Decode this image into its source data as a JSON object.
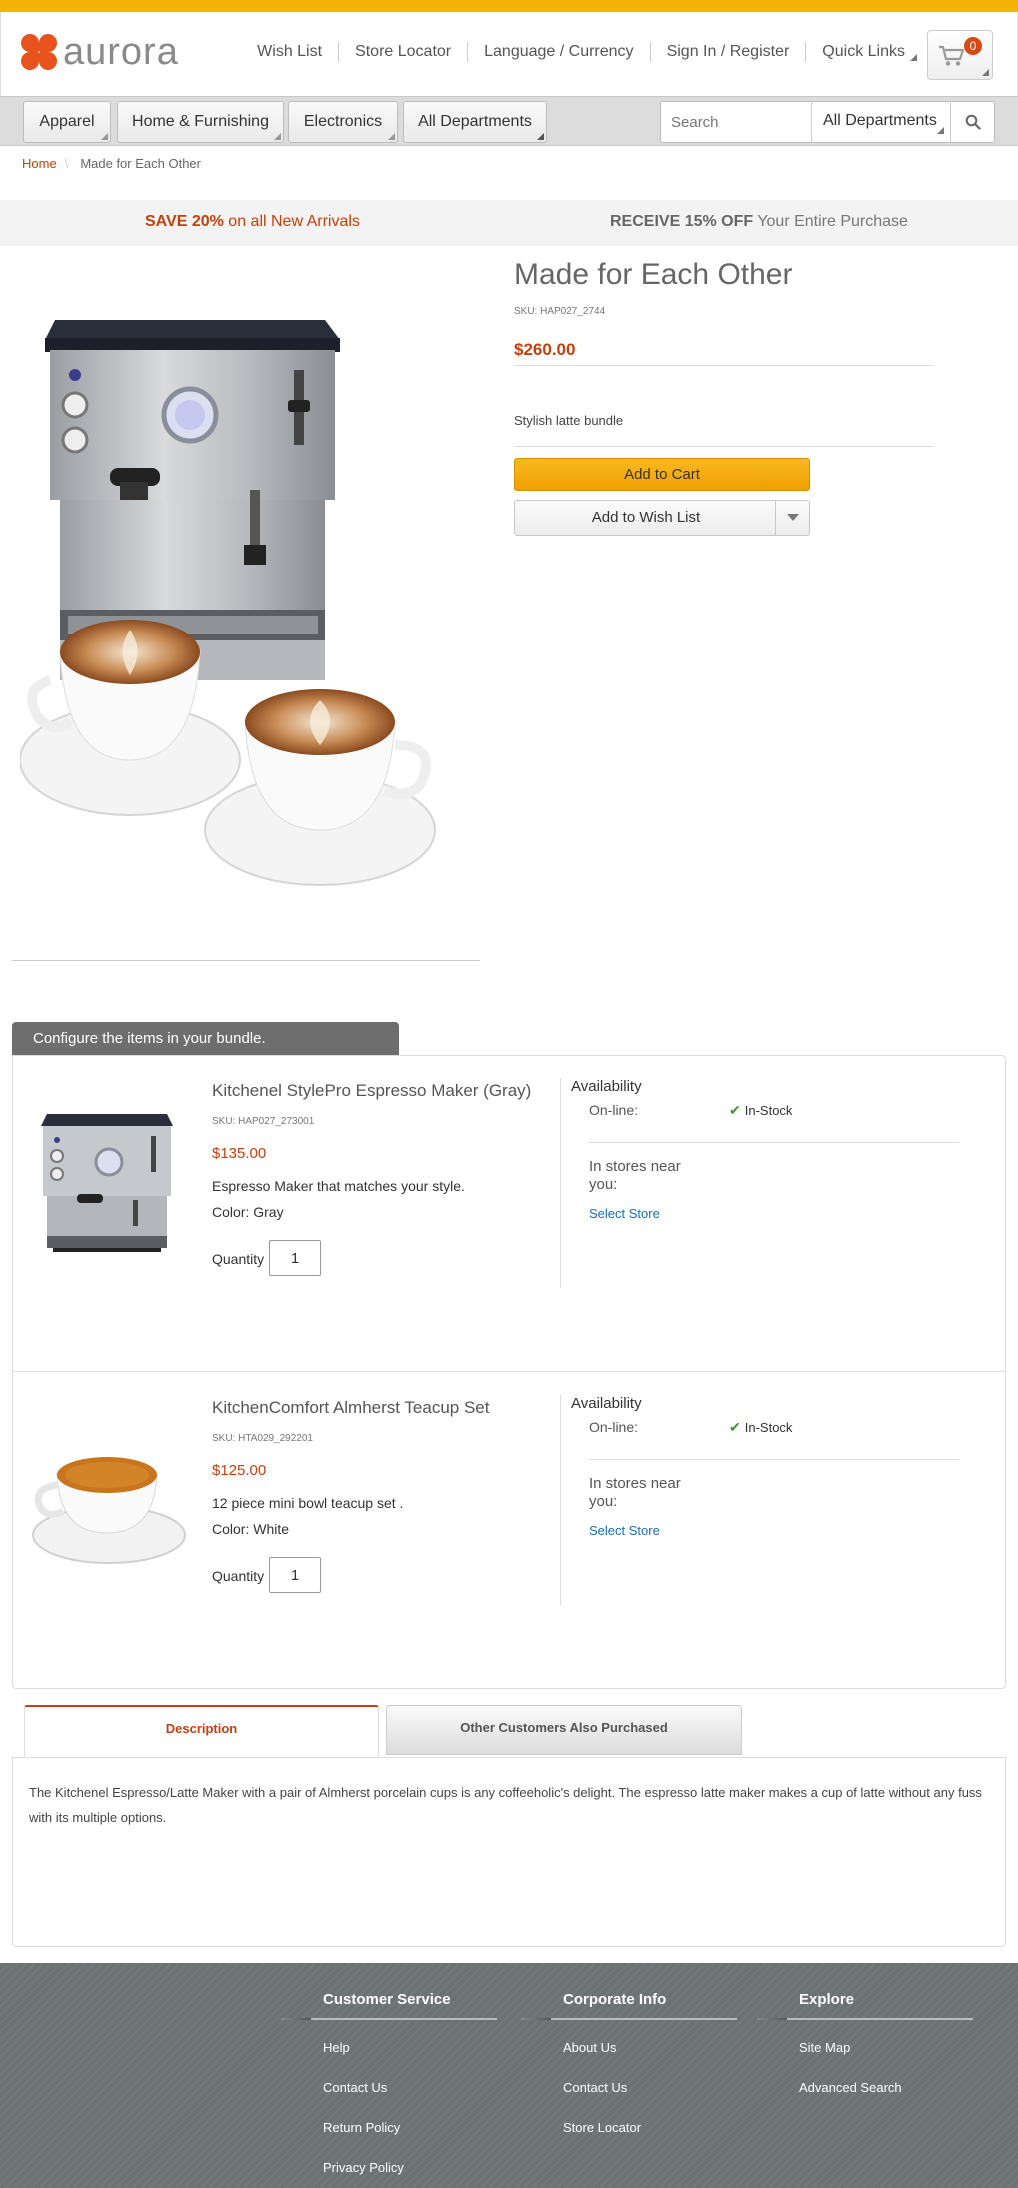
{
  "brand": {
    "name": "aurora"
  },
  "header": {
    "links": [
      "Wish List",
      "Store Locator",
      "Language / Currency",
      "Sign In / Register"
    ],
    "quick_links": "Quick Links",
    "cart_count": "0"
  },
  "nav": {
    "tabs": [
      "Apparel",
      "Home & Furnishing",
      "Electronics",
      "All Departments"
    ],
    "search_placeholder": "Search",
    "search_department": "All Departments"
  },
  "breadcrumb": {
    "home": "Home",
    "current": "Made for Each Other"
  },
  "promo": {
    "left_bold": "SAVE 20%",
    "left_rest": " on all New Arrivals",
    "right_bold": "RECEIVE 15% OFF",
    "right_rest": " Your Entire Purchase"
  },
  "product": {
    "title": "Made for Each Other",
    "sku": "SKU: HAP027_2744",
    "price": "$260.00",
    "description": "Stylish latte bundle",
    "add_to_cart": "Add to Cart",
    "add_to_wishlist": "Add to Wish List"
  },
  "bundle": {
    "heading": "Configure the items in your bundle.",
    "items": [
      {
        "name": "Kitchenel StylePro Espresso Maker (Gray)",
        "sku": "SKU: HAP027_273001",
        "price": "$135.00",
        "description": "Espresso Maker that matches your style.",
        "color": "Color: Gray",
        "quantity_label": "Quantity",
        "quantity": "1",
        "availability": "Availability",
        "online_label": "On-line:",
        "stock": "In-Stock",
        "stores_label": "In stores near you:",
        "select_store": "Select Store"
      },
      {
        "name": "KitchenComfort Almherst Teacup Set",
        "sku": "SKU: HTA029_292201",
        "price": "$125.00",
        "description": "12 piece mini bowl teacup set .",
        "color": "Color: White",
        "quantity_label": "Quantity",
        "quantity": "1",
        "availability": "Availability",
        "online_label": "On-line:",
        "stock": "In-Stock",
        "stores_label": "In stores near you:",
        "select_store": "Select Store"
      }
    ]
  },
  "tabs": {
    "description": "Description",
    "also_purchased": "Other Customers Also Purchased",
    "description_text": "The Kitchenel Espresso/Latte Maker with a pair of Almherst porcelain cups is any coffeeholic's delight. The espresso latte maker makes a cup of latte without any fuss with its multiple options."
  },
  "footer": {
    "columns": [
      {
        "title": "Customer Service",
        "links": [
          "Help",
          "Contact Us",
          "Return Policy",
          "Privacy Policy"
        ]
      },
      {
        "title": "Corporate Info",
        "links": [
          "About Us",
          "Contact Us",
          "Store Locator"
        ]
      },
      {
        "title": "Explore",
        "links": [
          "Site Map",
          "Advanced Search"
        ]
      }
    ]
  },
  "colors": {
    "accent": "#f5b30a",
    "brand": "#e8531d",
    "price": "#c2410c",
    "link": "#1a6db5",
    "footer": "#6c7272"
  },
  "icons": [
    "cart-icon",
    "search-icon",
    "chevron-down-icon",
    "check-icon"
  ]
}
